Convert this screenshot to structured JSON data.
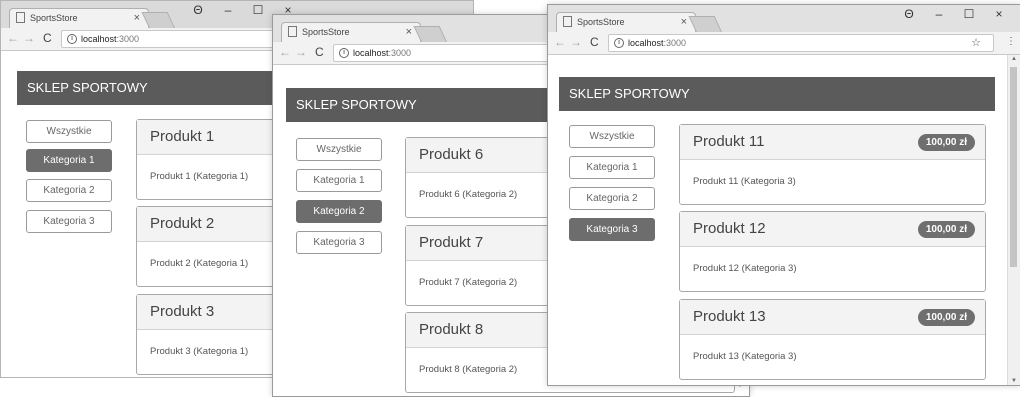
{
  "colors": {
    "header_bg": "#5b5b5b",
    "active_button": "#6d6d6d",
    "badge_bg": "#6f6f6f"
  },
  "browser": {
    "tab_title": "SportsStore",
    "tab_close": "×",
    "url_host": "localhost",
    "url_port": ":3000",
    "controls": {
      "profile": "Θ",
      "minimize": "–",
      "maximize": "☐",
      "close": "×"
    },
    "nav": {
      "back": "←",
      "forward": "→",
      "reload": "C"
    },
    "star": "☆",
    "menu": "⋮"
  },
  "store": {
    "title": "SKLEP SPORTOWY",
    "categories": [
      "Wszystkie",
      "Kategoria 1",
      "Kategoria 2",
      "Kategoria 3"
    ]
  },
  "windows": [
    {
      "active_category": 1,
      "products": [
        {
          "name": "Produkt 1",
          "description": "Produkt 1 (Kategoria 1)"
        },
        {
          "name": "Produkt 2",
          "description": "Produkt 2 (Kategoria 1)"
        },
        {
          "name": "Produkt 3",
          "description": "Produkt 3 (Kategoria 1)"
        }
      ]
    },
    {
      "active_category": 2,
      "products": [
        {
          "name": "Produkt 6",
          "description": "Produkt 6 (Kategoria 2)"
        },
        {
          "name": "Produkt 7",
          "description": "Produkt 7 (Kategoria 2)"
        },
        {
          "name": "Produkt 8",
          "description": "Produkt 8 (Kategoria 2)"
        }
      ]
    },
    {
      "active_category": 3,
      "products": [
        {
          "name": "Produkt 11",
          "description": "Produkt 11 (Kategoria 3)",
          "price": "100,00 zł"
        },
        {
          "name": "Produkt 12",
          "description": "Produkt 12 (Kategoria 3)",
          "price": "100,00 zł"
        },
        {
          "name": "Produkt 13",
          "description": "Produkt 13 (Kategoria 3)",
          "price": "100,00 zł"
        }
      ]
    }
  ]
}
